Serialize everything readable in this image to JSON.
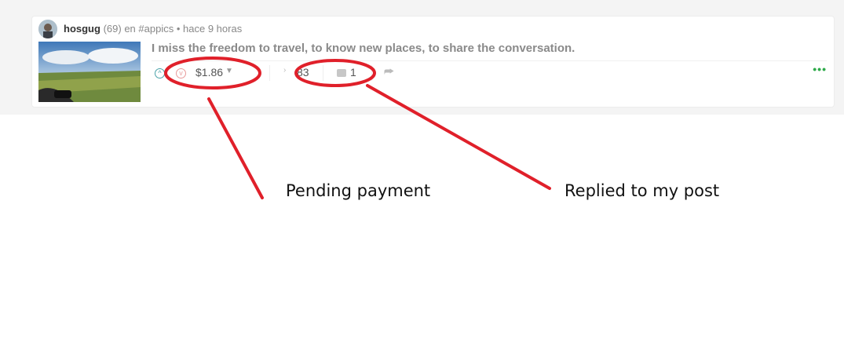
{
  "post": {
    "author": "hosgug",
    "reputation": "(69)",
    "category_prefix": "en",
    "category": "#appics",
    "separator": "•",
    "time": "hace 9 horas",
    "title": "I miss the freedom to travel, to know new places, to share the conversation."
  },
  "actions": {
    "upvote_icon": "chevron-up-icon",
    "downvote_icon": "chevron-down-icon",
    "payout": "$1.86",
    "votes_count": "83",
    "comments_count": "1",
    "reblog_icon": "reblog-icon",
    "more_icon": "•••"
  },
  "annotations": {
    "pending": "Pending payment",
    "replied": "Replied to my post",
    "color": "#e0202a"
  }
}
